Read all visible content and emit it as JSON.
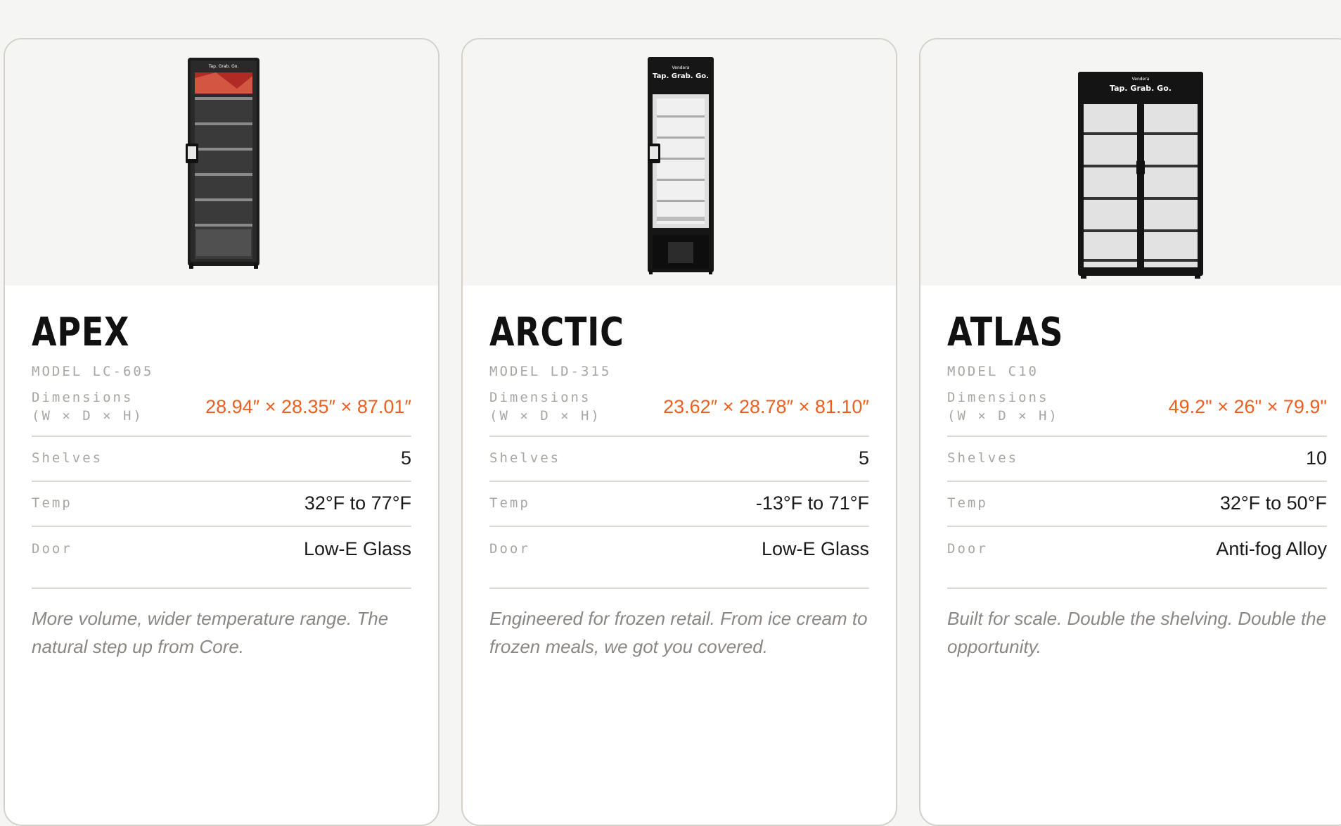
{
  "cards": [
    {
      "image_text": "Tap. Grab. Go.",
      "title": "APEX",
      "model": "MODEL LC-605",
      "dimensions": {
        "label_line1": "Dimensions",
        "label_line2": "(W × D × H)",
        "value": "28.94″ × 28.35″ × 87.01″"
      },
      "shelves": {
        "label": "Shelves",
        "value": "5"
      },
      "temp": {
        "label": "Temp",
        "value": "32°F to 77°F"
      },
      "door": {
        "label": "Door",
        "value": "Low-E Glass"
      },
      "description": "More volume, wider temperature range. The natural step up from Core."
    },
    {
      "image_brand": "Vendera",
      "image_text": "Tap. Grab. Go.",
      "title": "ARCTIC",
      "model": "MODEL LD-315",
      "dimensions": {
        "label_line1": "Dimensions",
        "label_line2": "(W × D × H)",
        "value": "23.62″ × 28.78″ × 81.10″"
      },
      "shelves": {
        "label": "Shelves",
        "value": "5"
      },
      "temp": {
        "label": "Temp",
        "value": "-13°F to 71°F"
      },
      "door": {
        "label": "Door",
        "value": "Low-E Glass"
      },
      "description": "Engineered for frozen retail. From ice cream to frozen meals, we got you covered."
    },
    {
      "image_brand": "Vendera",
      "image_text": "Tap. Grab. Go.",
      "title": "ATLAS",
      "model": "MODEL C10",
      "dimensions": {
        "label_line1": "Dimensions",
        "label_line2": "(W × D × H)",
        "value": "49.2\" × 26\" × 79.9\""
      },
      "shelves": {
        "label": "Shelves",
        "value": "10"
      },
      "temp": {
        "label": "Temp",
        "value": "32°F to 50°F"
      },
      "door": {
        "label": "Door",
        "value": "Anti-fog Alloy"
      },
      "description": "Built for scale. Double the shelving. Double the opportunity."
    }
  ],
  "colors": {
    "accent": "#ee5f1f",
    "page_background": "#f5f5f3",
    "card_border": "#d4d1cb",
    "muted_text": "#a9a6a1"
  }
}
